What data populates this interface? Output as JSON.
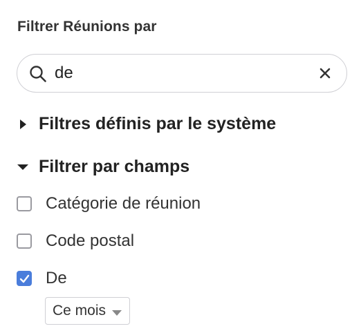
{
  "panel": {
    "title": "Filtrer Réunions par"
  },
  "search": {
    "value": "de",
    "placeholder": ""
  },
  "sections": {
    "system": {
      "label": "Filtres définis par le système",
      "expanded": false
    },
    "fields": {
      "label": "Filtrer par champs",
      "expanded": true
    }
  },
  "fields": [
    {
      "label": "Catégorie de réunion",
      "checked": false
    },
    {
      "label": "Code postal",
      "checked": false
    },
    {
      "label": "De",
      "checked": true
    }
  ],
  "de_filter": {
    "selected": "Ce mois"
  },
  "colors": {
    "accent": "#4a7ddb",
    "border": "#cfcfd4",
    "text": "#222222"
  }
}
